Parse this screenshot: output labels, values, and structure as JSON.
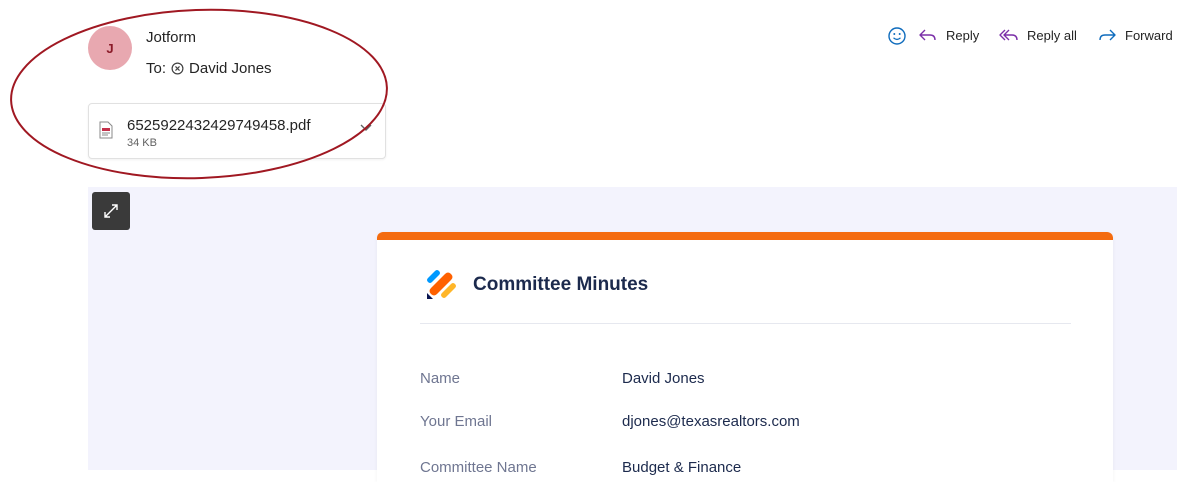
{
  "sender": {
    "initial": "J",
    "name": "Jotform",
    "to_label": "To:",
    "recipient": "David Jones"
  },
  "attachment": {
    "file_name": "6525922432429749458.pdf",
    "file_size": "34 KB"
  },
  "actions": {
    "reply": "Reply",
    "reply_all": "Reply all",
    "forward": "Forward"
  },
  "form": {
    "title": "Committee Minutes",
    "fields": [
      {
        "label": "Name",
        "value": "David Jones"
      },
      {
        "label": "Your Email",
        "value": "djones@texasrealtors.com"
      },
      {
        "label": "Committee Name",
        "value": "Budget & Finance"
      }
    ]
  },
  "colors": {
    "accent_orange": "#f46b0f",
    "annotation_red": "#a01822",
    "avatar_bg": "#e8a8b0",
    "action_purple": "#7b2fa8",
    "link_blue": "#0f6cbd"
  },
  "icons": [
    "emoji-icon",
    "reply-icon",
    "reply-all-icon",
    "forward-icon",
    "pdf-file-icon",
    "chevron-down-icon",
    "expand-icon",
    "jotform-logo",
    "remove-recipient-icon"
  ]
}
